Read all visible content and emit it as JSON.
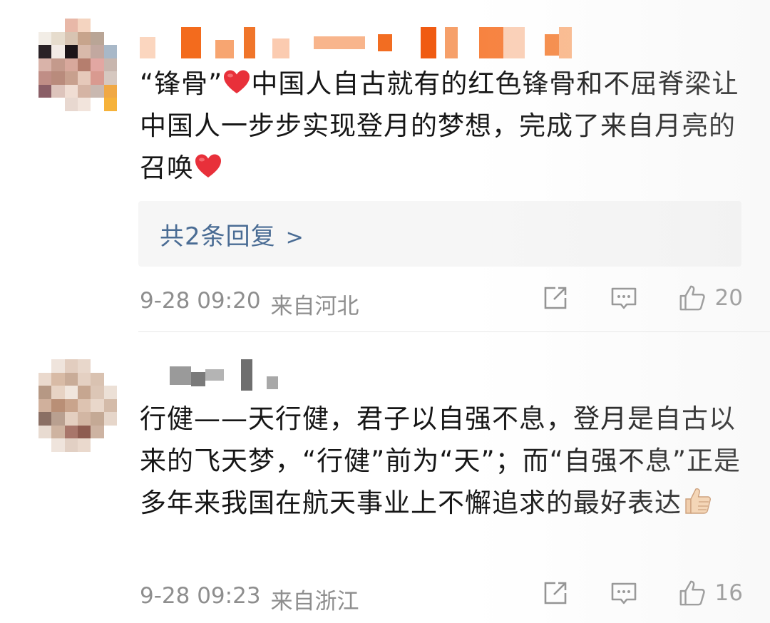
{
  "comments": [
    {
      "text_parts": [
        "“锋骨”",
        "中国人自古就有的红色锋骨和不屈脊梁让中国人一步步实现登月的梦想，完成了来自月亮的召唤"
      ],
      "reply_summary": "共2条回复",
      "reply_chevron": ">",
      "date": "9-28 09:20",
      "location": "来自河北",
      "likes": "20"
    },
    {
      "text_parts": [
        "行健——天行健，君子以自强不息，登月是自古以来的飞天梦，“行健”前为“天”；而“自强不息”正是多年来我国在航天事业上不懈追求的最好表达"
      ],
      "date": "9-28 09:23",
      "location": "来自浙江",
      "likes": "16"
    }
  ],
  "icons": {
    "share": "share-icon",
    "reply": "comment-icon",
    "like": "thumbs-up-icon",
    "heart": "red-heart-emoji",
    "thumb": "thumbs-up-emoji"
  },
  "colors": {
    "link": "#4a6c94",
    "meta": "#8e8e8e",
    "heart": "#e8303a"
  }
}
